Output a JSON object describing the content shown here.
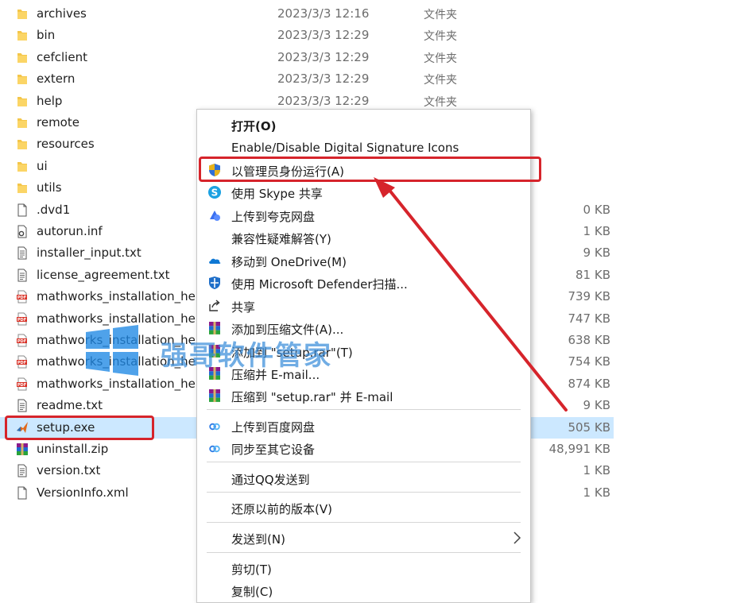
{
  "files": [
    {
      "name": "archives",
      "date": "2023/3/3 12:16",
      "type": "文件夹",
      "size": "",
      "icon": "folder-icon"
    },
    {
      "name": "bin",
      "date": "2023/3/3 12:29",
      "type": "文件夹",
      "size": "",
      "icon": "folder-icon"
    },
    {
      "name": "cefclient",
      "date": "2023/3/3 12:29",
      "type": "文件夹",
      "size": "",
      "icon": "folder-icon"
    },
    {
      "name": "extern",
      "date": "2023/3/3 12:29",
      "type": "文件夹",
      "size": "",
      "icon": "folder-icon"
    },
    {
      "name": "help",
      "date": "2023/3/3 12:29",
      "type": "文件夹",
      "size": "",
      "icon": "folder-icon"
    },
    {
      "name": "remote",
      "date": "",
      "type": "",
      "size": "",
      "icon": "folder-icon"
    },
    {
      "name": "resources",
      "date": "",
      "type": "",
      "size": "",
      "icon": "folder-icon"
    },
    {
      "name": "ui",
      "date": "",
      "type": "",
      "size": "",
      "icon": "folder-icon"
    },
    {
      "name": "utils",
      "date": "",
      "type": "",
      "size": "",
      "icon": "folder-icon"
    },
    {
      "name": ".dvd1",
      "date": "",
      "type": "",
      "size": "0 KB",
      "icon": "blank-file-icon"
    },
    {
      "name": "autorun.inf",
      "date": "",
      "type": "",
      "size": "1 KB",
      "icon": "settings-file-icon"
    },
    {
      "name": "installer_input.txt",
      "date": "",
      "type": "",
      "size": "9 KB",
      "icon": "text-file-icon"
    },
    {
      "name": "license_agreement.txt",
      "date": "",
      "type": "",
      "size": "81 KB",
      "icon": "text-file-icon"
    },
    {
      "name": "mathworks_installation_help",
      "date": "",
      "type": "",
      "size": "739 KB",
      "icon": "pdf-file-icon"
    },
    {
      "name": "mathworks_installation_help",
      "date": "",
      "type": "",
      "size": "747 KB",
      "icon": "pdf-file-icon"
    },
    {
      "name": "mathworks_installation_help",
      "date": "",
      "type": "",
      "size": "638 KB",
      "icon": "pdf-file-icon"
    },
    {
      "name": "mathworks_installation_help",
      "date": "",
      "type": "",
      "size": "754 KB",
      "icon": "pdf-file-icon"
    },
    {
      "name": "mathworks_installation_help",
      "date": "",
      "type": "",
      "size": "874 KB",
      "icon": "pdf-file-icon"
    },
    {
      "name": "readme.txt",
      "date": "",
      "type": "",
      "size": "9 KB",
      "icon": "text-file-icon"
    },
    {
      "name": "setup.exe",
      "date": "",
      "type": "",
      "size": "505 KB",
      "icon": "matlab-icon",
      "selected": true
    },
    {
      "name": "uninstall.zip",
      "date": "",
      "type": "",
      "size": "48,991 KB",
      "icon": "winrar-icon"
    },
    {
      "name": "version.txt",
      "date": "",
      "type": "",
      "size": "1 KB",
      "icon": "text-file-icon"
    },
    {
      "name": "VersionInfo.xml",
      "date": "",
      "type": "",
      "size": "1 KB",
      "icon": "blank-file-icon"
    }
  ],
  "context_menu": {
    "open": "打开(O)",
    "digital_signature": "Enable/Disable Digital Signature Icons",
    "run_as_admin": "以管理员身份运行(A)",
    "share_skype": "使用 Skype 共享",
    "upload_quark": "上传到夸克网盘",
    "compat_troubleshoot": "兼容性疑难解答(Y)",
    "move_onedrive": "移动到 OneDrive(M)",
    "defender_scan": "使用 Microsoft Defender扫描...",
    "share": "共享",
    "add_archive": "添加到压缩文件(A)...",
    "add_setup_rar": "添加到 \"setup.rar\"(T)",
    "compress_email": "压缩并 E-mail...",
    "compress_setup_email": "压缩到 \"setup.rar\" 并 E-mail",
    "upload_baidu": "上传到百度网盘",
    "sync_devices": "同步至其它设备",
    "send_qq": "通过QQ发送到",
    "restore_version": "还原以前的版本(V)",
    "send_to": "发送到(N)",
    "cut": "剪切(T)",
    "copy": "复制(C)"
  },
  "watermark": {
    "text": "强哥软件管家"
  },
  "colors": {
    "highlight_red": "#d6242b",
    "selection_blue": "#cce8ff",
    "folder_yellow": "#f4c64a",
    "watermark_blue": "#3b8edb"
  }
}
